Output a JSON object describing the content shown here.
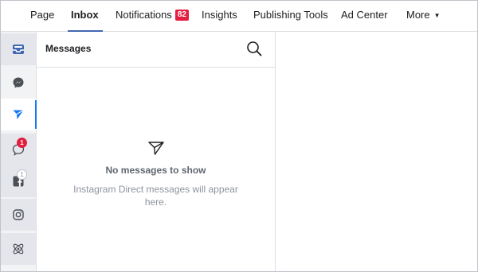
{
  "nav": {
    "tabs": [
      {
        "label": "Page"
      },
      {
        "label": "Inbox",
        "active": true
      },
      {
        "label": "Notifications",
        "badge": "82"
      },
      {
        "label": "Insights"
      },
      {
        "label": "Publishing Tools"
      },
      {
        "label": "Ad Center"
      },
      {
        "label": "More",
        "dropdown": true,
        "caret": "▼"
      }
    ]
  },
  "rail": {
    "items": [
      {
        "icon": "inbox-tray-icon"
      },
      {
        "icon": "messenger-icon"
      },
      {
        "icon": "instagram-direct-icon",
        "selected": true
      },
      {
        "icon": "comments-icon",
        "badge": "1"
      },
      {
        "icon": "facebook-posts-icon",
        "badge": "1"
      },
      {
        "icon": "instagram-icon"
      },
      {
        "icon": "automations-icon"
      }
    ]
  },
  "messages": {
    "title": "Messages",
    "empty_title": "No messages to show",
    "empty_description": "Instagram Direct messages will appear here."
  },
  "colors": {
    "accent": "#4267b2",
    "selected_indicator": "#1877f2",
    "badge": "#e41e3f"
  }
}
